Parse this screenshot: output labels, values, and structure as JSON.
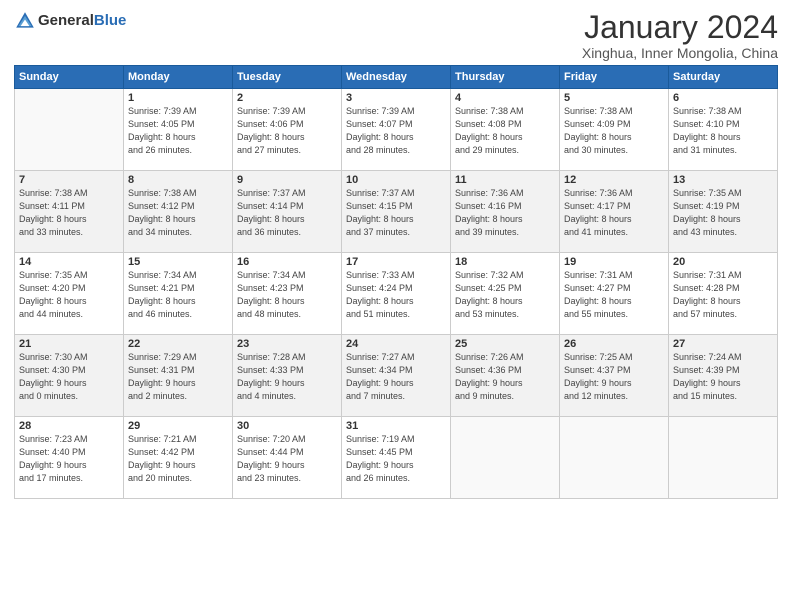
{
  "header": {
    "logo_general": "General",
    "logo_blue": "Blue",
    "month": "January 2024",
    "location": "Xinghua, Inner Mongolia, China"
  },
  "weekdays": [
    "Sunday",
    "Monday",
    "Tuesday",
    "Wednesday",
    "Thursday",
    "Friday",
    "Saturday"
  ],
  "weeks": [
    [
      {
        "day": "",
        "info": ""
      },
      {
        "day": "1",
        "info": "Sunrise: 7:39 AM\nSunset: 4:05 PM\nDaylight: 8 hours\nand 26 minutes."
      },
      {
        "day": "2",
        "info": "Sunrise: 7:39 AM\nSunset: 4:06 PM\nDaylight: 8 hours\nand 27 minutes."
      },
      {
        "day": "3",
        "info": "Sunrise: 7:39 AM\nSunset: 4:07 PM\nDaylight: 8 hours\nand 28 minutes."
      },
      {
        "day": "4",
        "info": "Sunrise: 7:38 AM\nSunset: 4:08 PM\nDaylight: 8 hours\nand 29 minutes."
      },
      {
        "day": "5",
        "info": "Sunrise: 7:38 AM\nSunset: 4:09 PM\nDaylight: 8 hours\nand 30 minutes."
      },
      {
        "day": "6",
        "info": "Sunrise: 7:38 AM\nSunset: 4:10 PM\nDaylight: 8 hours\nand 31 minutes."
      }
    ],
    [
      {
        "day": "7",
        "info": "Sunrise: 7:38 AM\nSunset: 4:11 PM\nDaylight: 8 hours\nand 33 minutes."
      },
      {
        "day": "8",
        "info": "Sunrise: 7:38 AM\nSunset: 4:12 PM\nDaylight: 8 hours\nand 34 minutes."
      },
      {
        "day": "9",
        "info": "Sunrise: 7:37 AM\nSunset: 4:14 PM\nDaylight: 8 hours\nand 36 minutes."
      },
      {
        "day": "10",
        "info": "Sunrise: 7:37 AM\nSunset: 4:15 PM\nDaylight: 8 hours\nand 37 minutes."
      },
      {
        "day": "11",
        "info": "Sunrise: 7:36 AM\nSunset: 4:16 PM\nDaylight: 8 hours\nand 39 minutes."
      },
      {
        "day": "12",
        "info": "Sunrise: 7:36 AM\nSunset: 4:17 PM\nDaylight: 8 hours\nand 41 minutes."
      },
      {
        "day": "13",
        "info": "Sunrise: 7:35 AM\nSunset: 4:19 PM\nDaylight: 8 hours\nand 43 minutes."
      }
    ],
    [
      {
        "day": "14",
        "info": "Sunrise: 7:35 AM\nSunset: 4:20 PM\nDaylight: 8 hours\nand 44 minutes."
      },
      {
        "day": "15",
        "info": "Sunrise: 7:34 AM\nSunset: 4:21 PM\nDaylight: 8 hours\nand 46 minutes."
      },
      {
        "day": "16",
        "info": "Sunrise: 7:34 AM\nSunset: 4:23 PM\nDaylight: 8 hours\nand 48 minutes."
      },
      {
        "day": "17",
        "info": "Sunrise: 7:33 AM\nSunset: 4:24 PM\nDaylight: 8 hours\nand 51 minutes."
      },
      {
        "day": "18",
        "info": "Sunrise: 7:32 AM\nSunset: 4:25 PM\nDaylight: 8 hours\nand 53 minutes."
      },
      {
        "day": "19",
        "info": "Sunrise: 7:31 AM\nSunset: 4:27 PM\nDaylight: 8 hours\nand 55 minutes."
      },
      {
        "day": "20",
        "info": "Sunrise: 7:31 AM\nSunset: 4:28 PM\nDaylight: 8 hours\nand 57 minutes."
      }
    ],
    [
      {
        "day": "21",
        "info": "Sunrise: 7:30 AM\nSunset: 4:30 PM\nDaylight: 9 hours\nand 0 minutes."
      },
      {
        "day": "22",
        "info": "Sunrise: 7:29 AM\nSunset: 4:31 PM\nDaylight: 9 hours\nand 2 minutes."
      },
      {
        "day": "23",
        "info": "Sunrise: 7:28 AM\nSunset: 4:33 PM\nDaylight: 9 hours\nand 4 minutes."
      },
      {
        "day": "24",
        "info": "Sunrise: 7:27 AM\nSunset: 4:34 PM\nDaylight: 9 hours\nand 7 minutes."
      },
      {
        "day": "25",
        "info": "Sunrise: 7:26 AM\nSunset: 4:36 PM\nDaylight: 9 hours\nand 9 minutes."
      },
      {
        "day": "26",
        "info": "Sunrise: 7:25 AM\nSunset: 4:37 PM\nDaylight: 9 hours\nand 12 minutes."
      },
      {
        "day": "27",
        "info": "Sunrise: 7:24 AM\nSunset: 4:39 PM\nDaylight: 9 hours\nand 15 minutes."
      }
    ],
    [
      {
        "day": "28",
        "info": "Sunrise: 7:23 AM\nSunset: 4:40 PM\nDaylight: 9 hours\nand 17 minutes."
      },
      {
        "day": "29",
        "info": "Sunrise: 7:21 AM\nSunset: 4:42 PM\nDaylight: 9 hours\nand 20 minutes."
      },
      {
        "day": "30",
        "info": "Sunrise: 7:20 AM\nSunset: 4:44 PM\nDaylight: 9 hours\nand 23 minutes."
      },
      {
        "day": "31",
        "info": "Sunrise: 7:19 AM\nSunset: 4:45 PM\nDaylight: 9 hours\nand 26 minutes."
      },
      {
        "day": "",
        "info": ""
      },
      {
        "day": "",
        "info": ""
      },
      {
        "day": "",
        "info": ""
      }
    ]
  ]
}
